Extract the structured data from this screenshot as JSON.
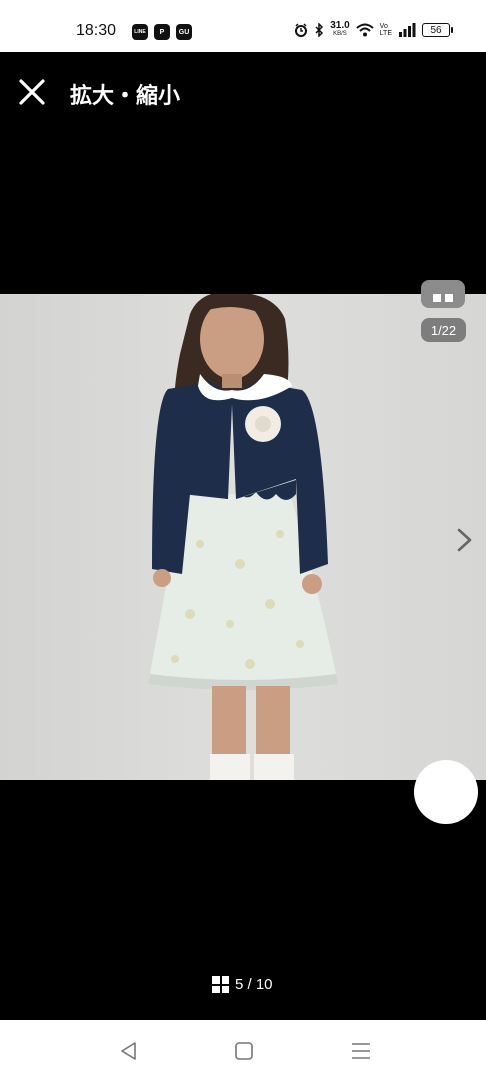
{
  "status_bar": {
    "time": "18:30",
    "apps": [
      "LINE",
      "P",
      "GU"
    ],
    "net_speed_value": "31.0",
    "net_speed_unit": "KB/S",
    "volte_top": "Vo",
    "volte_bottom": "LTE",
    "battery": "56"
  },
  "header": {
    "title": "拡大・縮小",
    "close_icon": "close-icon"
  },
  "image_viewer": {
    "image_counter": "1/22",
    "page_indicator": "5 / 10"
  },
  "colors": {
    "background": "#000000",
    "status_bar_bg": "#ffffff",
    "pill_bg": "#7d7d7d"
  }
}
